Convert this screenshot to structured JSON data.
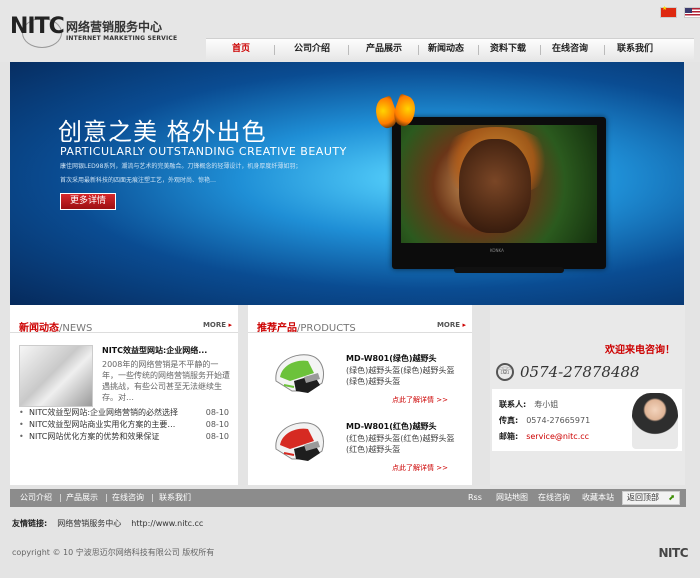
{
  "header": {
    "logo_mark": "NITC",
    "logo_cn": "网络营销服务中心",
    "logo_en": "INTERNET MARKETING SERVICE"
  },
  "nav": {
    "items": [
      {
        "label": "首页",
        "active": true
      },
      {
        "label": "公司介绍"
      },
      {
        "label": "产品展示"
      },
      {
        "label": "新闻动态"
      },
      {
        "label": "资料下载"
      },
      {
        "label": "在线咨询"
      },
      {
        "label": "联系我们"
      }
    ]
  },
  "banner": {
    "title": "创意之美   格外出色",
    "subtitle": "PARTICULARLY OUTSTANDING CREATIVE BEAUTY",
    "desc_line1": "康佳网银LED98系列，潮流与艺术的完美融合。刀锋概念的轻薄设计，机身厚度纤薄如羽；",
    "desc_line2": "首次采用最新科技的四面无痕注塑工艺，外观时尚、惊艳…",
    "button": "更多详情",
    "tv_brand": "KONKA"
  },
  "news": {
    "title": "新闻动态",
    "title_en": "/NEWS",
    "more": "MORE",
    "feature_title": "NITC效益型网站:企业网络...",
    "feature_desc": "2008年的网络营销是不平静的一年，一些传统的网络营销服务开始遭遇挑战，有些公司甚至无法继续生存。对…",
    "items": [
      {
        "title": "NITC效益型网站:企业网络营销的必然选择",
        "date": "08-10"
      },
      {
        "title": "NITC效益型网站商业实用化方案的主要…",
        "date": "08-10"
      },
      {
        "title": "NITC网站优化方案的优势和效果保证",
        "date": "08-10"
      }
    ]
  },
  "products": {
    "title": "推荐产品",
    "title_en": "/PRODUCTS",
    "more": "MORE",
    "items": [
      {
        "name": "MD-W801(绿色)越野头",
        "desc": "(绿色)越野头盔(绿色)越野头盔(绿色)越野头盔",
        "link": "点此了解详情 >>"
      },
      {
        "name": "MD-W801(红色)越野头",
        "desc": "(红色)越野头盔(红色)越野头盔(红色)越野头盔",
        "link": "点此了解详情 >>"
      }
    ]
  },
  "contact": {
    "welcome": "欢迎来电咨询！",
    "phone": "0574-27878488",
    "person_label": "联系人:",
    "person": "寿小姐",
    "fax_label": "传真:",
    "fax": "0574-27665971",
    "email_label": "邮箱:",
    "email": "service@nitc.cc"
  },
  "footer_bar": {
    "left_links": [
      "公司介绍",
      "产品展示",
      "在线咨询",
      "联系我们"
    ],
    "right_links": [
      "Rss",
      "网站地图",
      "在线咨询",
      "收藏本站"
    ],
    "back_top": "返回顶部"
  },
  "friend_links": {
    "label": "友情链接:",
    "items": [
      "网络营销服务中心",
      "http://www.nitc.cc"
    ]
  },
  "copyright": "copyright © 10 宁波思迈尔网络科技有限公司  版权所有",
  "footer_logo": "NITC"
}
